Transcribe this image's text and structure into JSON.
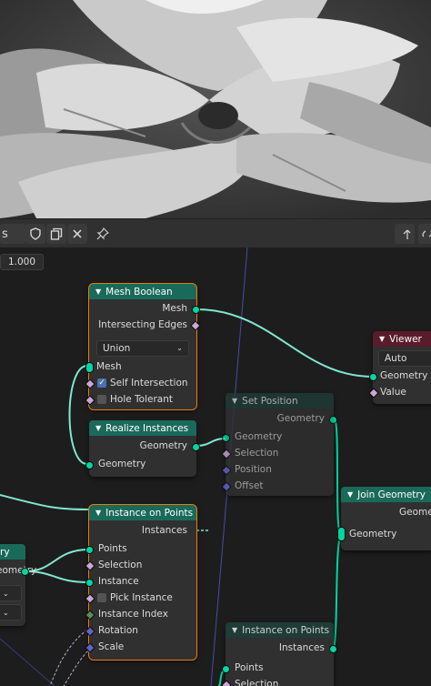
{
  "header": {
    "name_fragment": "s",
    "shield_icon": "shield-icon",
    "copy_icon": "duplicate-icon",
    "close_icon": "close-icon",
    "pin_icon": "pin-icon"
  },
  "value_field": "1.000",
  "nodes": {
    "mesh_boolean": {
      "title": "Mesh Boolean",
      "out_mesh": "Mesh",
      "out_intersecting": "Intersecting Edges",
      "operation": "Union",
      "in_mesh": "Mesh",
      "self_intersection": "Self Intersection",
      "hole_tolerant": "Hole Tolerant"
    },
    "realize_instances": {
      "title": "Realize Instances",
      "out_geometry": "Geometry",
      "in_geometry": "Geometry"
    },
    "set_position": {
      "title": "Set Position",
      "out_geometry": "Geometry",
      "in_geometry": "Geometry",
      "selection": "Selection",
      "position": "Position",
      "offset": "Offset"
    },
    "viewer": {
      "title": "Viewer",
      "domain": "Auto",
      "geometry": "Geometry",
      "value": "Value"
    },
    "join_geometry": {
      "title": "Join Geometry",
      "out_geometry": "Geometry",
      "in_geometry": "Geometry"
    },
    "instance_on_points_1": {
      "title": "Instance on Points",
      "out_instances": "Instances",
      "points": "Points",
      "selection": "Selection",
      "instance": "Instance",
      "pick_instance": "Pick Instance",
      "instance_index": "Instance Index",
      "rotation": "Rotation",
      "scale": "Scale"
    },
    "instance_on_points_2": {
      "title": "Instance on Points",
      "out_instances": "Instances",
      "points": "Points",
      "selection": "Selection"
    },
    "left_node": {
      "title_fragment": "ry",
      "out_fragment": "eometry"
    }
  }
}
